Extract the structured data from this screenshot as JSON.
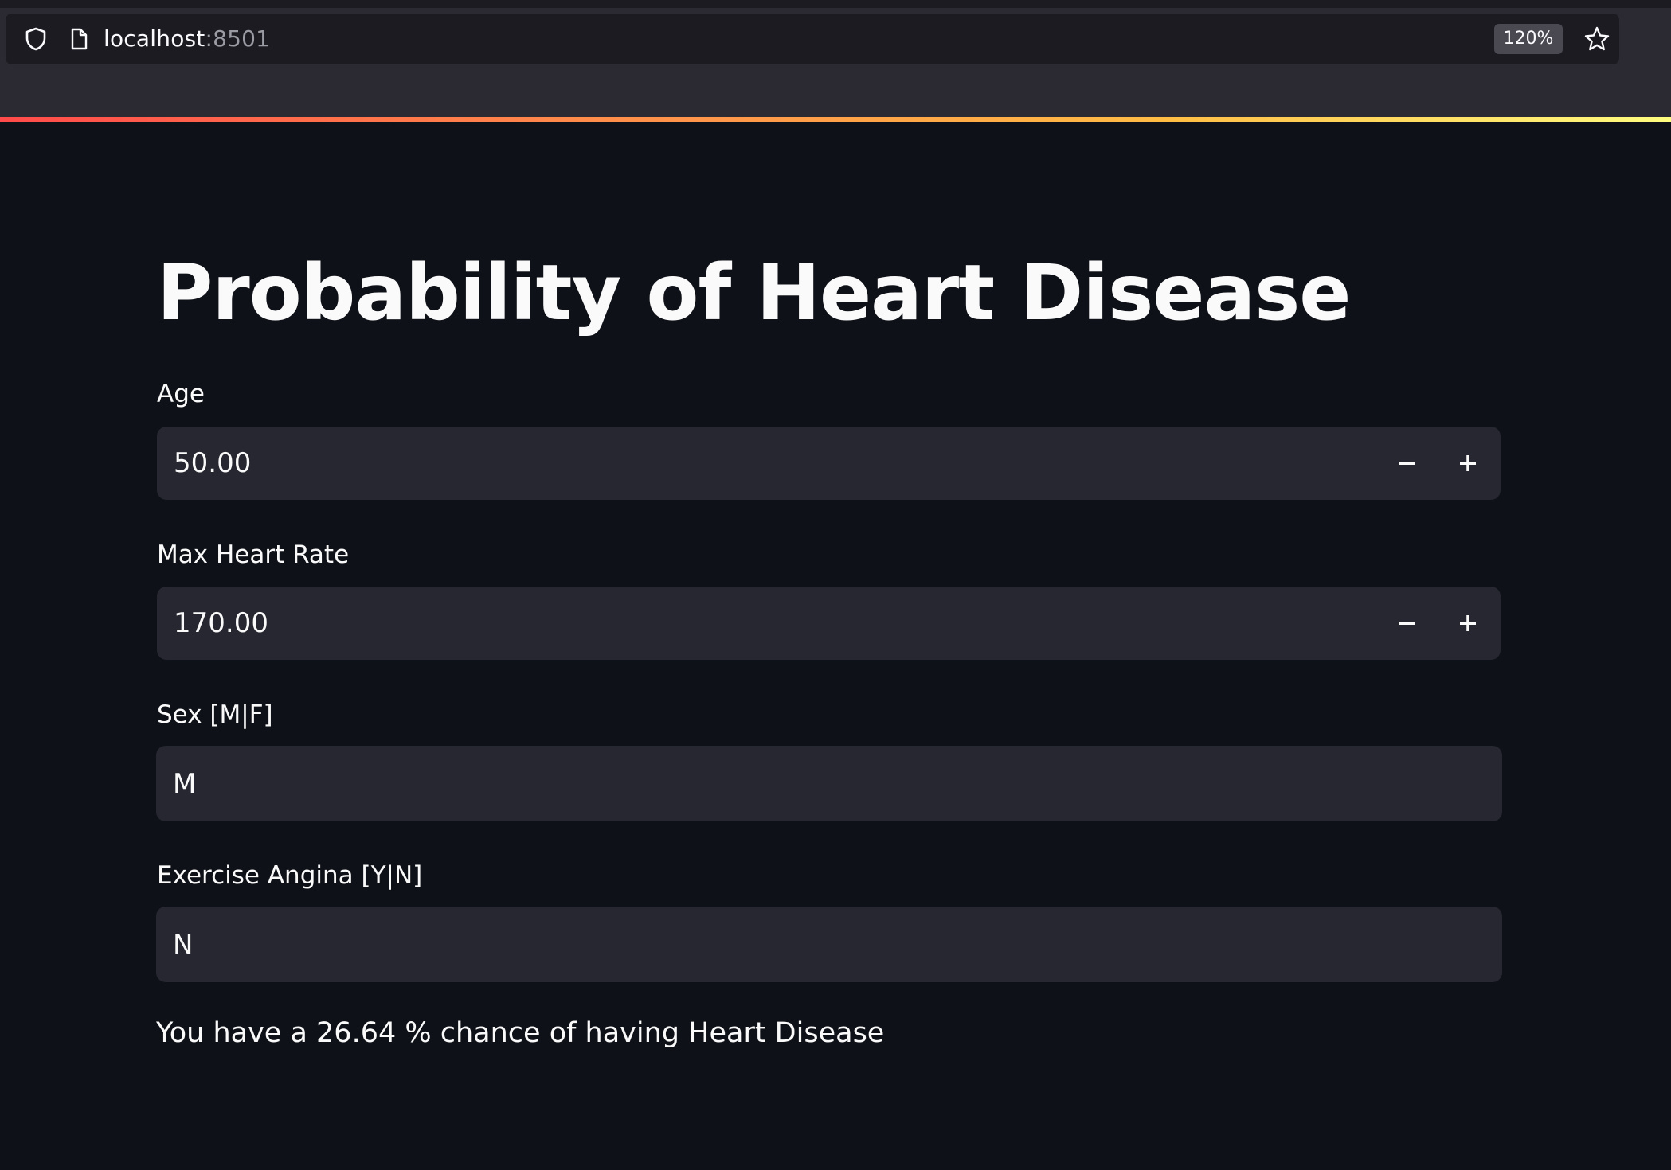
{
  "browser": {
    "url_host": "localhost",
    "url_port": ":8501",
    "zoom": "120%",
    "icons": [
      "shield-icon",
      "page-icon",
      "star-icon"
    ]
  },
  "theme": {
    "background": "#0e1117",
    "input_background": "#262730",
    "text": "#fafafa",
    "accent_gradient": [
      "#ff4b4b",
      "#fffd80"
    ]
  },
  "page": {
    "title": "Probability of Heart Disease"
  },
  "form": {
    "age": {
      "label": "Age",
      "value": "50.00",
      "minus": "−",
      "plus": "+"
    },
    "max_heart_rate": {
      "label": "Max Heart Rate",
      "value": "170.00",
      "minus": "−",
      "plus": "+"
    },
    "sex": {
      "label": "Sex [M|F]",
      "value": "M"
    },
    "exercise_angina": {
      "label": "Exercise Angina [Y|N]",
      "value": "N"
    }
  },
  "result": {
    "text": "You have a 26.64 % chance of having Heart Disease"
  }
}
